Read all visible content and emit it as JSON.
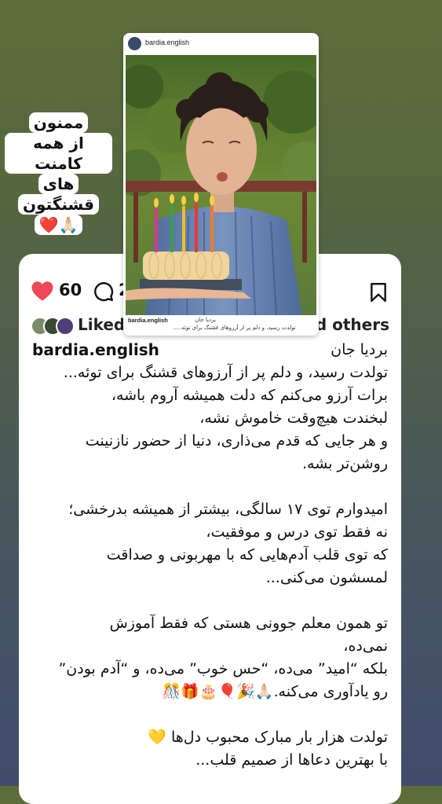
{
  "sticker": {
    "lines": [
      "ممنون",
      "از همه کامنت",
      "های",
      "قشنگتون",
      "🙏🏻❤️"
    ]
  },
  "post_card": {
    "like_count": "60",
    "comment_count": "2",
    "liked_by_prefix": "Liked",
    "liked_by_suffix": "d others",
    "username": "bardia.english",
    "caption_lines": [
      "بردیا جان",
      "تولدت رسید، و دلم پر از آرزوهای قشنگ برای توئه...",
      "برات آرزو می‌کنم که دلت همیشه آروم باشه،",
      "لبخندت هیچ‌وقت خاموش نشه،",
      "و هر جایی که قدم می‌ذاری، دنیا از حضور نازنینت",
      "روشن‌تر بشه.",
      "",
      "امیدوارم توی ۱۷ سالگی، بیشتر از همیشه بدرخشی؛",
      "نه فقط توی درس و موفقیت،",
      "که توی قلب آدم‌هایی که با مهربونی و صداقت",
      "لمسشون می‌کنی...",
      "",
      "تو همون معلم جوونی هستی که فقط آموزش",
      "نمی‌ده،",
      "بلکه “امید” می‌ده، “حس خوب” می‌ده، و “آدم بودن”",
      "رو یادآوری می‌کنه.🙏🏻🎉🎈🎂🎁🎊",
      "",
      "تولدت هزار بار مبارک محبوب دل‌ها 💛",
      "با بهترین دعاها از صمیم قلب..."
    ]
  },
  "shared_post": {
    "username": "bardia.english",
    "caption_user": "bardia.english",
    "caption_line1": "بردیا جان",
    "caption_line2": "تولدت رسید، و دلم پر از آرزوهای قشنگ برای توئه....."
  },
  "colors": {
    "heart": "#ed4956",
    "background_top": "#5d6d3a",
    "background_bottom": "#414c6c"
  },
  "icons": {
    "like": "heart-icon",
    "comment": "comment-icon",
    "save": "bookmark-icon"
  }
}
